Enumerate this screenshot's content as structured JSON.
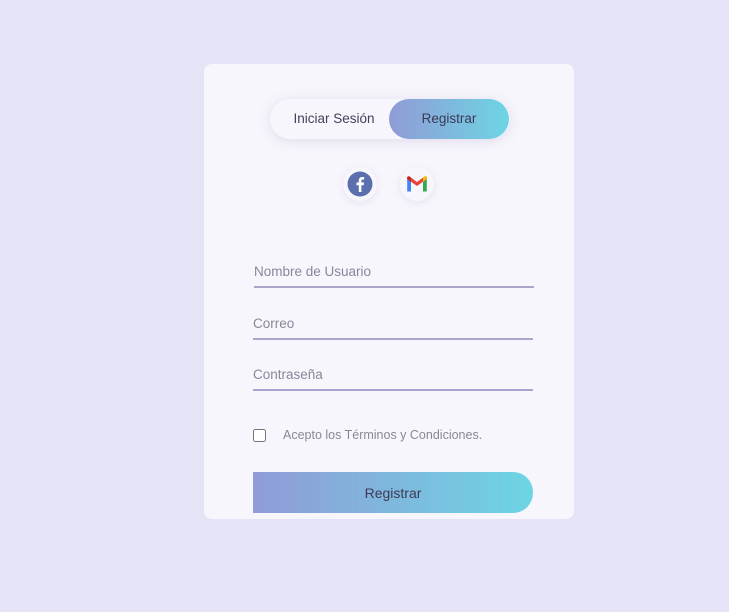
{
  "toggle": {
    "login_label": "Iniciar Sesión",
    "register_label": "Registrar"
  },
  "social": {
    "facebook_icon": "facebook-icon",
    "gmail_icon": "gmail-icon"
  },
  "form": {
    "username_placeholder": "Nombre de Usuario",
    "email_placeholder": "Correo",
    "password_placeholder": "Contraseña",
    "terms_label": "Acepto los Términos y Condiciones.",
    "submit_label": "Registrar"
  },
  "colors": {
    "background": "#e5e4f6",
    "card": "#f7f6fc",
    "gradient_start": "#909bd6",
    "gradient_end": "#6dd5e4",
    "field_underline": "#a9a5cd",
    "facebook": "#5b6fae"
  }
}
